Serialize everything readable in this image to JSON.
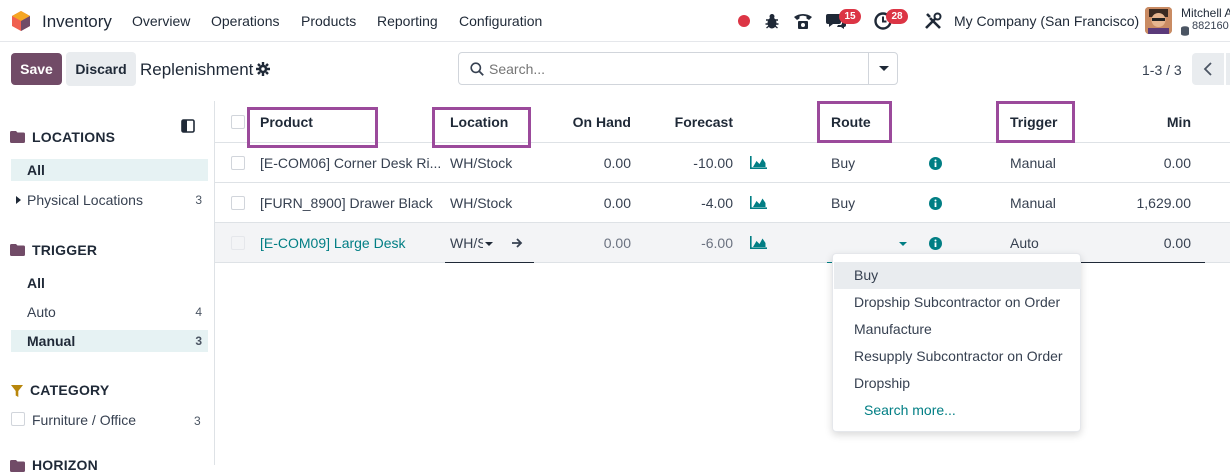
{
  "navbar": {
    "app_name": "Inventory",
    "menu": [
      "Overview",
      "Operations",
      "Products",
      "Reporting",
      "Configuration"
    ],
    "messages_badge": "15",
    "activities_badge": "28",
    "company": "My Company (San Francisco)",
    "user_name": "Mitchell A",
    "user_db": "882160"
  },
  "control_panel": {
    "save_label": "Save",
    "discard_label": "Discard",
    "title": "Replenishment",
    "search_placeholder": "Search...",
    "pager": "1-3 / 3"
  },
  "sidebar": {
    "locations": {
      "title": "LOCATIONS",
      "items": [
        {
          "label": "All",
          "count": "",
          "active": true
        },
        {
          "label": "Physical Locations",
          "count": "3",
          "active": false
        }
      ]
    },
    "trigger": {
      "title": "TRIGGER",
      "items": [
        {
          "label": "All",
          "count": ""
        },
        {
          "label": "Auto",
          "count": "4"
        },
        {
          "label": "Manual",
          "count": "3"
        }
      ]
    },
    "category": {
      "title": "CATEGORY",
      "items": [
        {
          "label": "Furniture / Office",
          "count": "3"
        }
      ]
    },
    "next_section_title": "HORIZON"
  },
  "table": {
    "headers": {
      "product": "Product",
      "location": "Location",
      "on_hand": "On Hand",
      "forecast": "Forecast",
      "route": "Route",
      "trigger": "Trigger",
      "min": "Min"
    },
    "rows": [
      {
        "product": "[E-COM06] Corner Desk Ri...",
        "location": "WH/Stock",
        "on_hand": "0.00",
        "forecast": "-10.00",
        "route": "Buy",
        "trigger": "Manual",
        "min": "0.00"
      },
      {
        "product": "[FURN_8900] Drawer Black",
        "location": "WH/Stock",
        "on_hand": "0.00",
        "forecast": "-4.00",
        "route": "Buy",
        "trigger": "Manual",
        "min": "1,629.00"
      },
      {
        "product": "[E-COM09] Large Desk",
        "location": "WH/St",
        "on_hand": "0.00",
        "forecast": "-6.00",
        "route": "",
        "trigger": "Auto",
        "min": "0.00"
      }
    ]
  },
  "route_dropdown": {
    "options": [
      "Buy",
      "Dropship Subcontractor on Order",
      "Manufacture",
      "Resupply Subcontractor on Order",
      "Dropship"
    ],
    "search_more": "Search more..."
  },
  "colors": {
    "accent_purple": "#714b67",
    "highlight_border": "#9b4a9b",
    "teal": "#017e84",
    "badge_red": "#dc3545"
  }
}
